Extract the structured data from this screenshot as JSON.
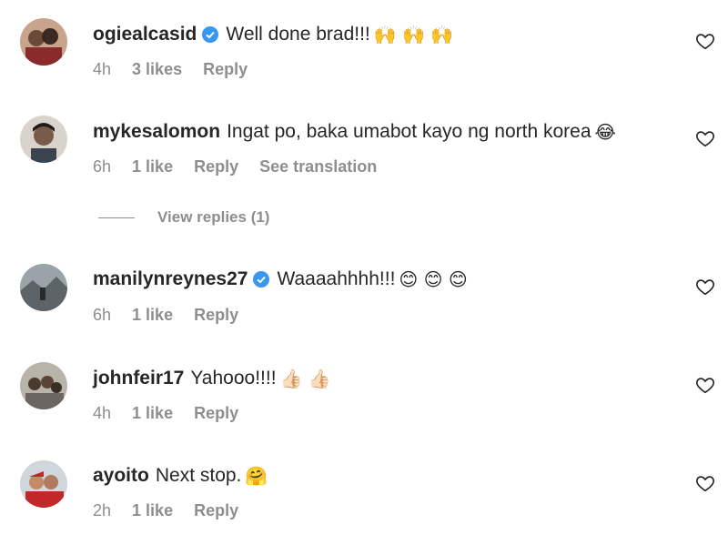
{
  "comments": [
    {
      "username": "ogiealcasid",
      "verified": true,
      "text": "Well done brad!!!",
      "emoji": "🙌 🙌 🙌",
      "time": "4h",
      "likes": "3 likes",
      "reply": "Reply",
      "avatar": "avatar-couple"
    },
    {
      "username": "mykesalomon",
      "verified": false,
      "text": "Ingat po, baka umabot kayo ng north korea",
      "emoji": "😂",
      "time": "6h",
      "likes": "1 like",
      "reply": "Reply",
      "translate": "See translation",
      "avatar": "avatar-man"
    },
    {
      "username": "manilynreynes27",
      "verified": true,
      "text": "Waaaahhhh!!!",
      "emoji": "😊 😊 😊",
      "time": "6h",
      "likes": "1 like",
      "reply": "Reply",
      "avatar": "avatar-landscape"
    },
    {
      "username": "johnfeir17",
      "verified": false,
      "text": "Yahooo!!!!",
      "emoji": "👍🏻 👍🏻",
      "time": "4h",
      "likes": "1 like",
      "reply": "Reply",
      "avatar": "avatar-group"
    },
    {
      "username": "ayoito",
      "verified": false,
      "text": "Next stop.",
      "emoji": "🤗",
      "time": "2h",
      "likes": "1 like",
      "reply": "Reply",
      "avatar": "avatar-couple-red"
    }
  ],
  "view_replies": "View replies (1)",
  "colors": {
    "verified": "#3897f0",
    "meta": "#8e8e8e",
    "text": "#262626"
  }
}
